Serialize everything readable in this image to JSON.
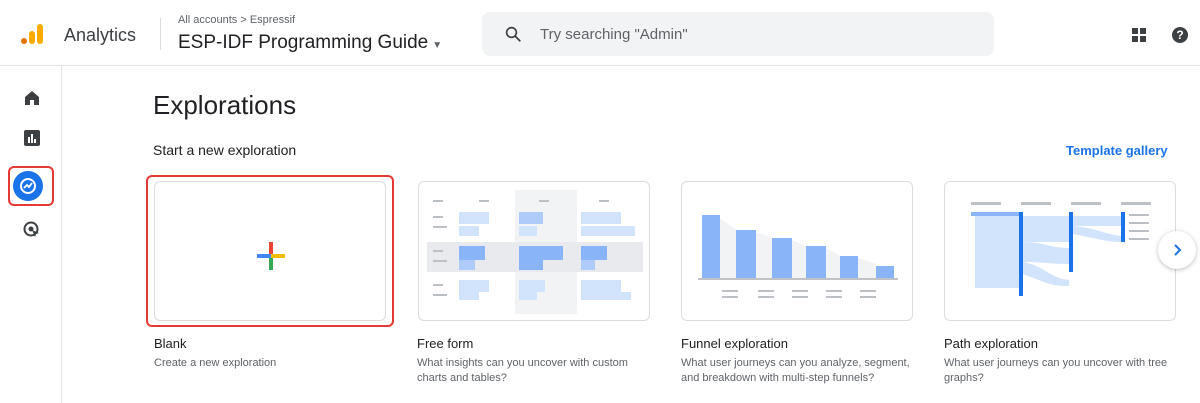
{
  "header": {
    "product_name": "Analytics",
    "breadcrumb": "All accounts > Espressif",
    "property_name": "ESP-IDF Programming Guide",
    "search_placeholder": "Try searching \"Admin\""
  },
  "rail": {
    "items": [
      {
        "name": "home-icon"
      },
      {
        "name": "reports-icon"
      },
      {
        "name": "explore-icon",
        "active": true
      },
      {
        "name": "advertising-icon"
      }
    ]
  },
  "main": {
    "title": "Explorations",
    "section_title": "Start a new exploration",
    "template_gallery": "Template gallery",
    "cards": [
      {
        "title": "Blank",
        "desc": "Create a new exploration"
      },
      {
        "title": "Free form",
        "desc": "What insights can you uncover with custom charts and tables?"
      },
      {
        "title": "Funnel exploration",
        "desc": "What user journeys can you analyze, segment, and breakdown with multi-step funnels?"
      },
      {
        "title": "Path exploration",
        "desc": "What user journeys can you uncover with tree graphs?"
      }
    ]
  },
  "colors": {
    "accent": "#1a73e8",
    "highlight": "#e53935",
    "illustration": "#8ab4f8"
  }
}
